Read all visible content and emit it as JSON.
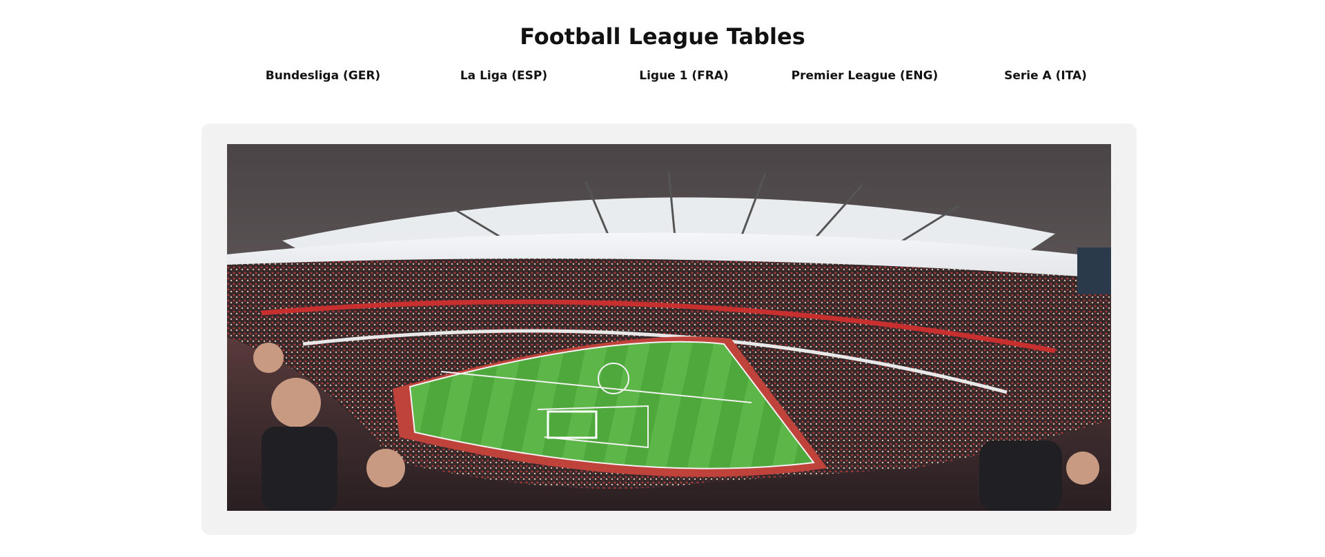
{
  "page": {
    "title": "Football League Tables"
  },
  "nav": {
    "leagues": [
      {
        "label": "Bundesliga (GER)"
      },
      {
        "label": "La Liga (ESP)"
      },
      {
        "label": "Ligue 1 (FRA)"
      },
      {
        "label": "Premier League (ENG)"
      },
      {
        "label": "Serie A (ITA)"
      }
    ]
  },
  "hero": {
    "image": "stadium-panorama-photo"
  }
}
